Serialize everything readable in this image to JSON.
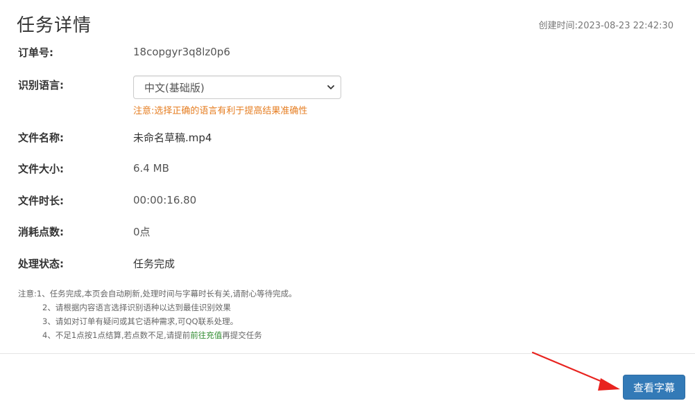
{
  "header": {
    "title": "任务详情",
    "created_label": "创建时间:",
    "created_value": "2023-08-23 22:42:30"
  },
  "fields": {
    "order_no": {
      "label": "订单号:",
      "value": "18copgyr3q8lz0p6"
    },
    "language": {
      "label": "识别语言:",
      "selected": "中文(基础版)",
      "hint": "注意:选择正确的语言有利于提高结果准确性"
    },
    "file_name": {
      "label": "文件名称:",
      "value": "未命名草稿.mp4"
    },
    "file_size": {
      "label": "文件大小:",
      "value": "6.4 MB"
    },
    "duration": {
      "label": "文件时长:",
      "value": "00:00:16.80"
    },
    "points": {
      "label": "消耗点数:",
      "value": "0点"
    },
    "status": {
      "label": "处理状态:",
      "value": "任务完成"
    }
  },
  "notes": {
    "line1": "注意:1、任务完成,本页会自动刷新,处理时间与字幕时长有关,请耐心等待完成。",
    "line2": "2、请根据内容语言选择识别语种以达到最佳识别效果",
    "line3": "3、请如对订单有疑问或其它语种需求,可QQ联系处理。",
    "line4_prefix": "4、不足1点按1点结算,若点数不足,请提前",
    "line4_link": "前往充值",
    "line4_suffix": "再提交任务"
  },
  "actions": {
    "view_subtitles": "查看字幕"
  },
  "icons": {
    "select_chevron": "chevron-down-icon",
    "annotation_arrow": "arrow-icon"
  },
  "colors": {
    "primary_button": "#337ab7",
    "hint": "#e67e22",
    "link": "#2e8b2e",
    "annotation_arrow": "#e8231f"
  }
}
